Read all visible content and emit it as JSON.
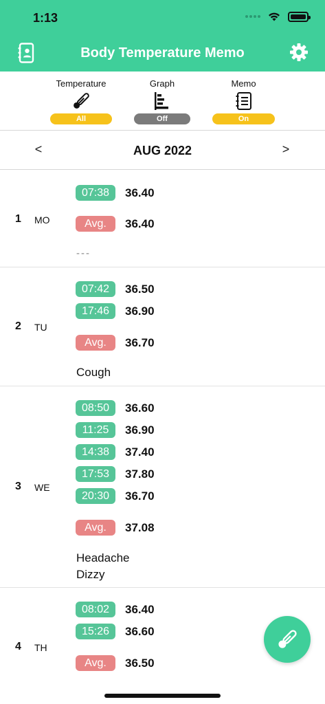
{
  "status": {
    "time": "1:13"
  },
  "header": {
    "title": "Body Temperature Memo",
    "bg_color": "#3fcf9a"
  },
  "toolbar": {
    "temperature": {
      "label": "Temperature",
      "state": "All",
      "icon": "thermometer-icon"
    },
    "graph": {
      "label": "Graph",
      "state": "Off",
      "icon": "bar-chart-icon"
    },
    "memo": {
      "label": "Memo",
      "state": "On",
      "icon": "notebook-icon"
    }
  },
  "month_nav": {
    "prev": "<",
    "month": "AUG 2022",
    "next": ">"
  },
  "days": [
    {
      "num": "1",
      "weekday": "MO",
      "times": [
        {
          "time": "07:38",
          "temp": "36.40"
        }
      ],
      "avg_label": "Avg.",
      "avg": "36.40",
      "memo": [
        "---"
      ]
    },
    {
      "num": "2",
      "weekday": "TU",
      "times": [
        {
          "time": "07:42",
          "temp": "36.50"
        },
        {
          "time": "17:46",
          "temp": "36.90"
        }
      ],
      "avg_label": "Avg.",
      "avg": "36.70",
      "memo": [
        "Cough"
      ]
    },
    {
      "num": "3",
      "weekday": "WE",
      "times": [
        {
          "time": "08:50",
          "temp": "36.60"
        },
        {
          "time": "11:25",
          "temp": "36.90"
        },
        {
          "time": "14:38",
          "temp": "37.40"
        },
        {
          "time": "17:53",
          "temp": "37.80"
        },
        {
          "time": "20:30",
          "temp": "36.70"
        }
      ],
      "avg_label": "Avg.",
      "avg": "37.08",
      "memo": [
        "Headache",
        "Dizzy"
      ]
    },
    {
      "num": "4",
      "weekday": "TH",
      "times": [
        {
          "time": "08:02",
          "temp": "36.40"
        },
        {
          "time": "15:26",
          "temp": "36.60"
        }
      ],
      "avg_label": "Avg.",
      "avg": "36.50",
      "memo": []
    }
  ],
  "colors": {
    "time_chip": "#56c598",
    "avg_chip": "#e88585",
    "pill_on": "#f6c21b",
    "pill_off": "#7b7b7b"
  }
}
